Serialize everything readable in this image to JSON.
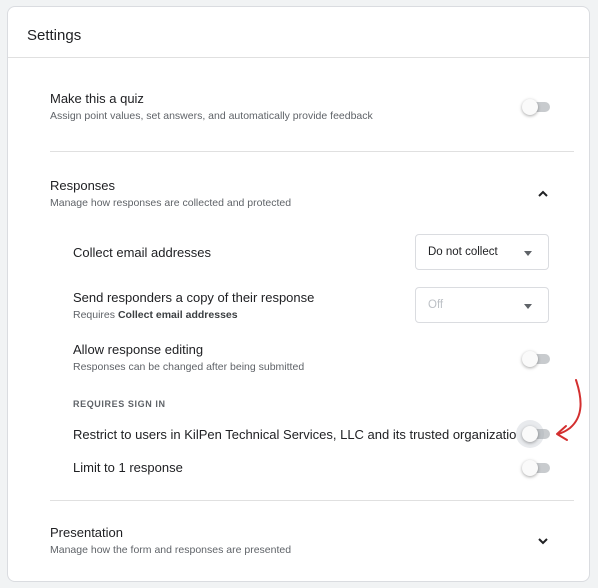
{
  "settings": {
    "title": "Settings",
    "quiz": {
      "label": "Make this a quiz",
      "description": "Assign point values, set answers, and automatically provide feedback",
      "enabled": false
    },
    "responses": {
      "title": "Responses",
      "description": "Manage how responses are collected and protected",
      "expanded": true,
      "collect_email": {
        "label": "Collect email addresses",
        "selected": "Do not collect"
      },
      "send_copy": {
        "label": "Send responders a copy of their response",
        "requires_prefix": "Requires",
        "requires_bold": "Collect email addresses",
        "selected": "Off",
        "disabled": true
      },
      "allow_editing": {
        "label": "Allow response editing",
        "description": "Responses can be changed after being submitted",
        "enabled": false
      },
      "requires_sign_in": "REQUIRES SIGN IN",
      "restrict_users": {
        "label": "Restrict to users in KilPen Technical Services, LLC and its trusted organizations",
        "enabled": false
      },
      "limit_one": {
        "label": "Limit to 1 response",
        "enabled": false
      }
    },
    "presentation": {
      "title": "Presentation",
      "description": "Manage how the form and responses are presented",
      "expanded": false
    }
  },
  "colors": {
    "annotation_arrow": "#d32f2f",
    "toggle_off_track": "#9aa0a6",
    "divider": "#e0e0e0"
  },
  "icons": {
    "responses_chevron": "chevron-up-icon",
    "presentation_chevron": "chevron-down-icon",
    "dropdown": "arrow-drop-down-icon"
  }
}
